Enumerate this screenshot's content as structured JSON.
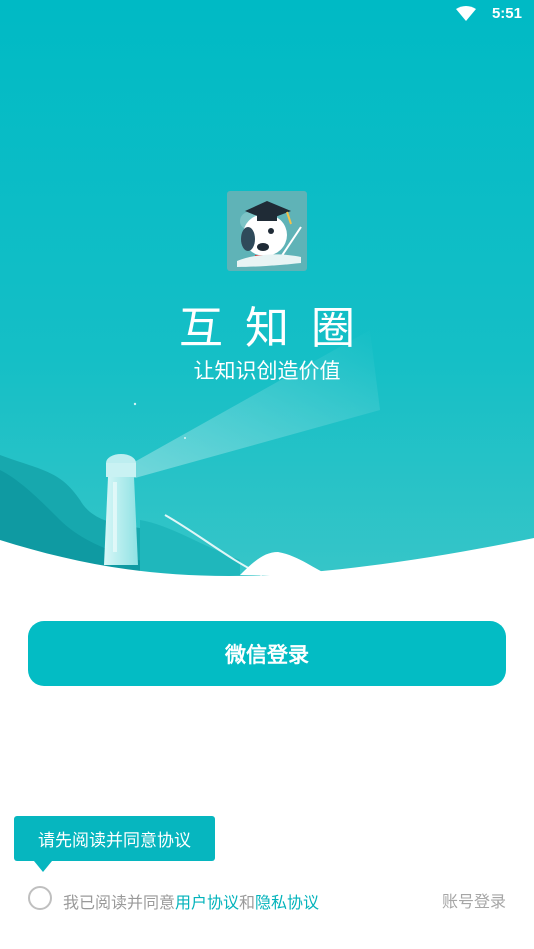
{
  "status_bar": {
    "time": "5:51",
    "wifi_icon": "wifi-icon"
  },
  "brand": {
    "logo_icon": "dog-graduate-logo-icon",
    "app_name": "互知圈",
    "slogan": "让知识创造价值"
  },
  "actions": {
    "wechat_login": "微信登录",
    "account_login": "账号登录"
  },
  "agreement": {
    "tooltip": "请先阅读并同意协议",
    "prefix": "我已阅读并同意",
    "user_agreement": "用户协议",
    "and": "和",
    "privacy_agreement": "隐私协议",
    "checked": false
  },
  "colors": {
    "primary": "#03bcc4",
    "hero_top": "#00bcc6",
    "hero_bottom": "#2fc3c7",
    "link": "#03b3bb"
  }
}
